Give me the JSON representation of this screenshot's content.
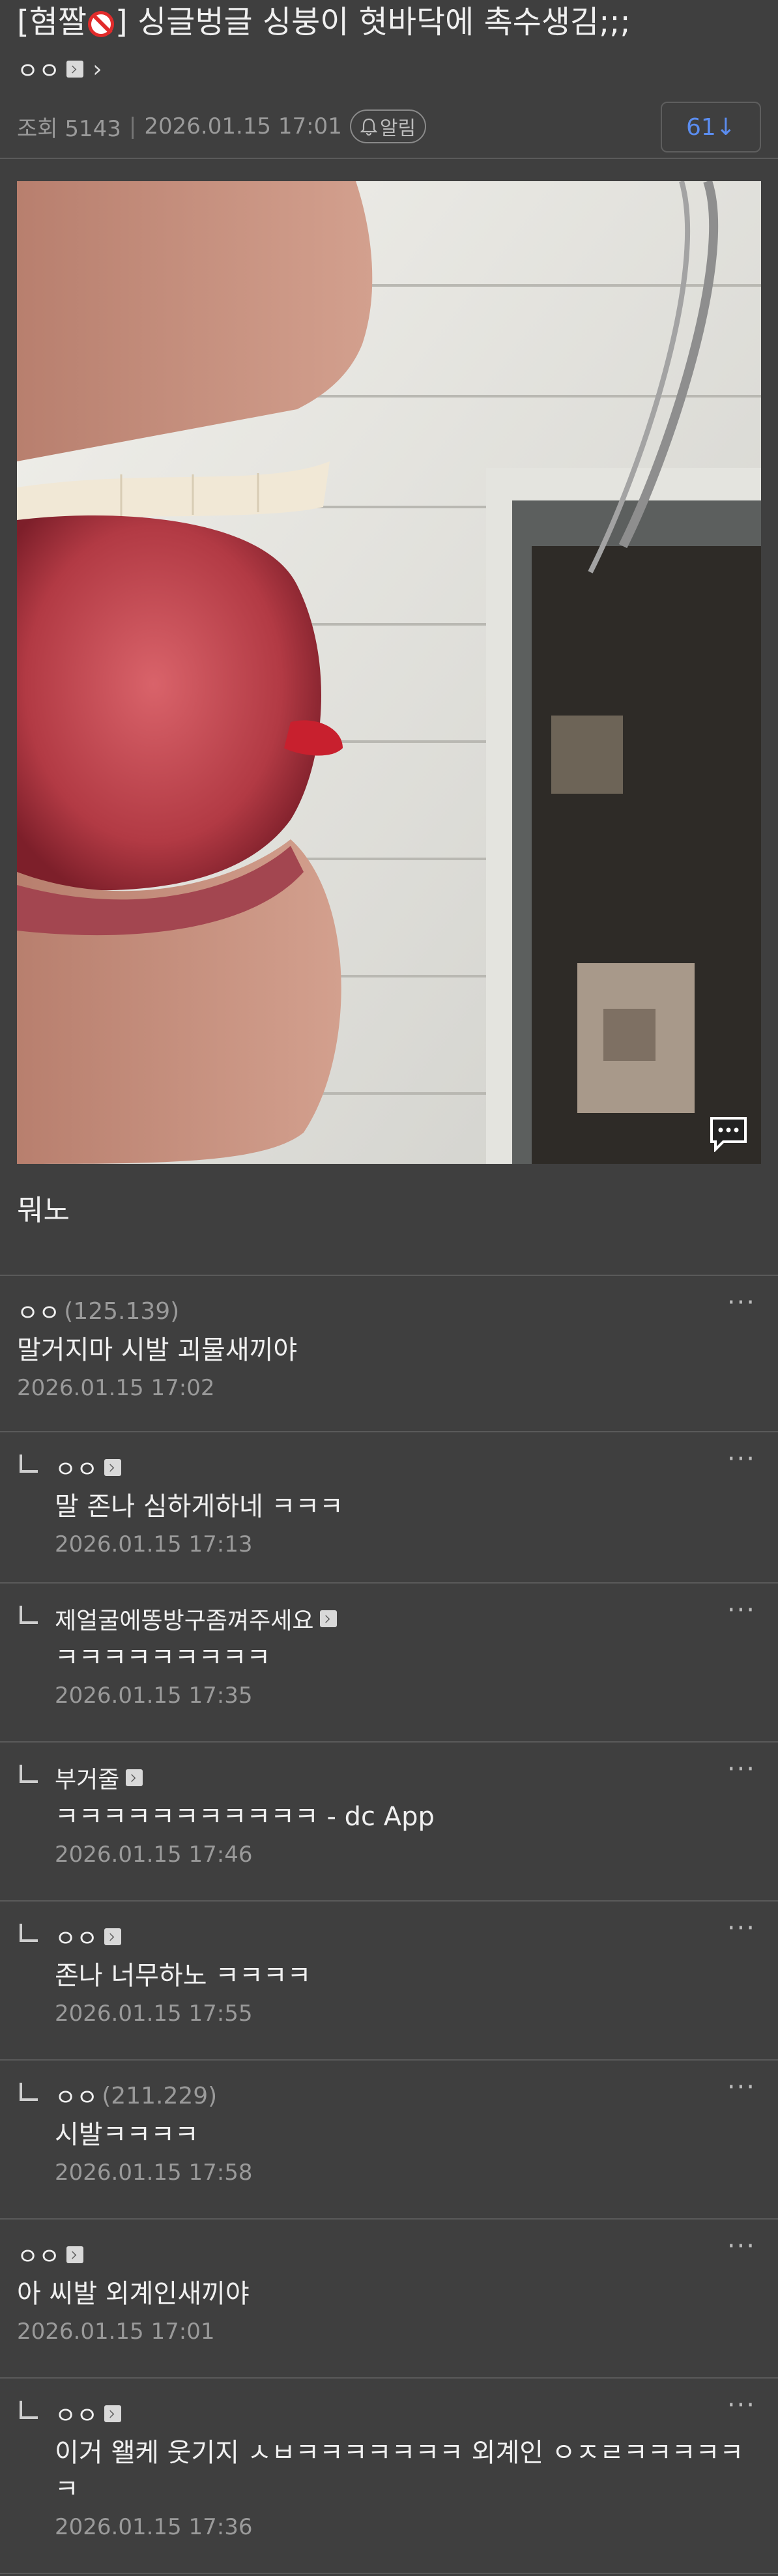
{
  "post": {
    "title_prefix": "[혐짤",
    "title_suffix": "] 싱글벙글 싱붕이 혓바닥에 촉수생김;;;",
    "author": "ㅇㅇ",
    "author_chevron": "›",
    "views_label": "조회 5143",
    "datetime": "2026.01.15 17:01",
    "alarm_label": "알림",
    "comment_count": "61↓",
    "body": "뭐노"
  },
  "icons": {
    "no_entry": "no-entry-icon",
    "gallog": "gallog-icon",
    "bell": "bell-icon",
    "image_comment": "image-comment-icon",
    "more": "more-icon",
    "reply": "reply-arrow-icon"
  },
  "comments": [
    {
      "author": "ㅇㅇ",
      "ip": "(125.139)",
      "text": "말거지마 시발 괴물새끼야",
      "date": "2026.01.15 17:02",
      "more": "···"
    },
    {
      "author": "ㅇㅇ",
      "text": "말 존나 심하게하네 ㅋㅋㅋ",
      "date": "2026.01.15 17:13",
      "more": "···"
    },
    {
      "author": "제얼굴에똥방구좀껴주세요",
      "text": "ㅋㅋㅋㅋㅋㅋㅋㅋㅋ",
      "date": "2026.01.15 17:35",
      "more": "···"
    },
    {
      "author": "부거줄",
      "text": "ㅋㅋㅋㅋㅋㅋㅋㅋㅋㅋㅋ - dc App",
      "date": "2026.01.15 17:46",
      "more": "···"
    },
    {
      "author": "ㅇㅇ",
      "text": "존나 너무하노 ㅋㅋㅋㅋ",
      "date": "2026.01.15 17:55",
      "more": "···"
    },
    {
      "author": "ㅇㅇ",
      "ip": "(211.229)",
      "text": "시발ㅋㅋㅋㅋ",
      "date": "2026.01.15 17:58",
      "more": "···"
    },
    {
      "author": "ㅇㅇ",
      "text": "아 씨발 외계인새끼야",
      "date": "2026.01.15 17:01",
      "more": "···"
    },
    {
      "author": "ㅇㅇ",
      "text": "이거 왤케 웃기지 ㅅㅂㅋㅋㅋㅋㅋㅋㅋ 외계인 ㅇㅈㄹㅋㅋㅋㅋㅋㅋ",
      "date": "2026.01.15 17:36",
      "more": "···"
    }
  ],
  "colors": {
    "background": "#3f3f3f",
    "accent": "#5b8df0",
    "muted_text": "#9a9a9a"
  }
}
